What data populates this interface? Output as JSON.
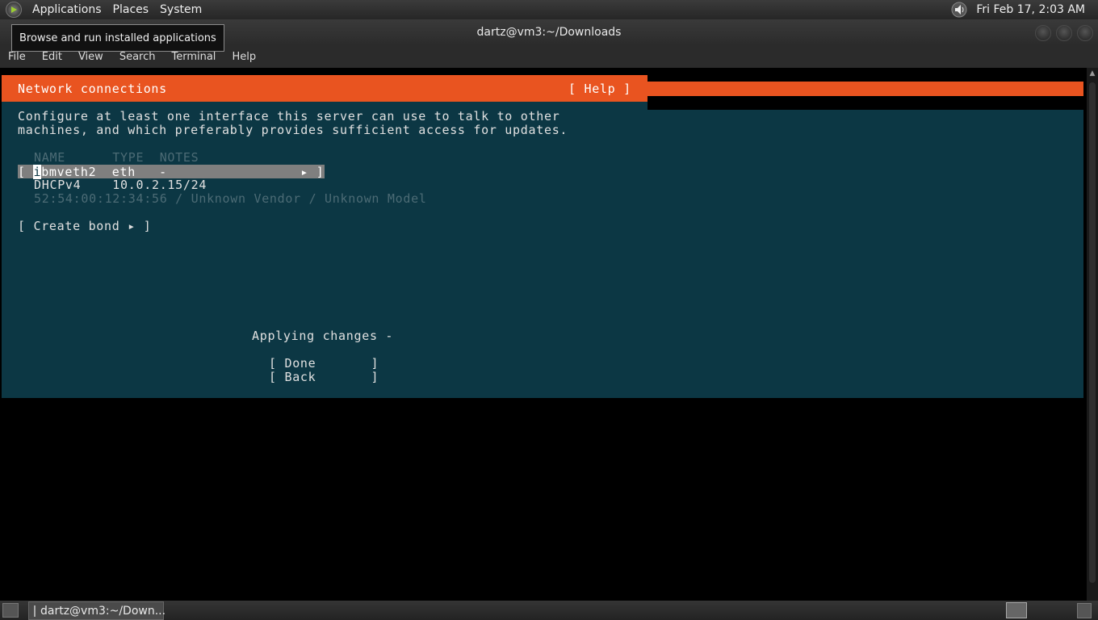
{
  "top_panel": {
    "menus": [
      "Applications",
      "Places",
      "System"
    ],
    "clock": "Fri Feb 17,  2:03 AM"
  },
  "tooltip": "Browse and run installed applications",
  "window": {
    "title": "dartz@vm3:~/Downloads",
    "menu": [
      "File",
      "Edit",
      "View",
      "Search",
      "Terminal",
      "Help"
    ]
  },
  "installer": {
    "title": "Network connections",
    "help": "[ Help ]",
    "intro_line1": "Configure at least one interface this server can use to talk to other",
    "intro_line2": "machines, and which preferably provides sufficient access for updates.",
    "columns_header": "NAME      TYPE  NOTES",
    "interface": {
      "open_bracket": "[ ",
      "cursor_char": "i",
      "row_rest": "bmveth2  eth   -                 ▸ ]",
      "dhcp_line": "DHCPv4    10.0.2.15/24",
      "mac_line": "52:54:00:12:34:56 / Unknown Vendor / Unknown Model"
    },
    "create_bond": "[ Create bond ▸ ]",
    "status": "Applying changes -",
    "done_button": "[ Done       ]",
    "back_button": "[ Back       ]"
  },
  "taskbar": {
    "task_label": "dartz@vm3:~/Down..."
  },
  "colors": {
    "orange": "#e95420",
    "installer_bg": "#0c3744",
    "selection": "#7f7f7f"
  }
}
